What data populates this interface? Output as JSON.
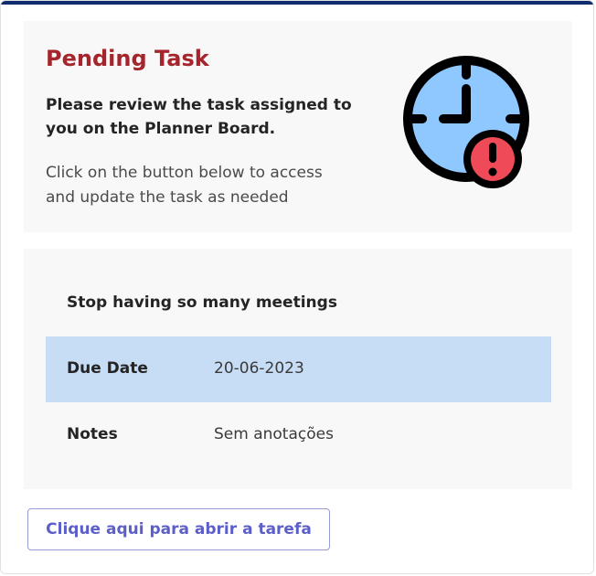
{
  "hero": {
    "title": "Pending Task",
    "line1": "Please review the task assigned to you on the Planner Board.",
    "line2": "Click on the button below to access and update the task as needed",
    "icon": "clock-alert-icon"
  },
  "task": {
    "title": "Stop having so many meetings",
    "fields": [
      {
        "label": "Due Date",
        "value": "20-06-2023"
      },
      {
        "label": "Notes",
        "value": "Sem anotações"
      }
    ]
  },
  "action": {
    "label": "Clique aqui para abrir a tarefa"
  },
  "colors": {
    "accent_bar": "#0f2c6e",
    "title": "#a4262c",
    "highlight_row": "#c7dcf5",
    "button_text": "#5b5fc7",
    "clock_face": "#8ec8ff",
    "alert": "#ef4a57"
  }
}
